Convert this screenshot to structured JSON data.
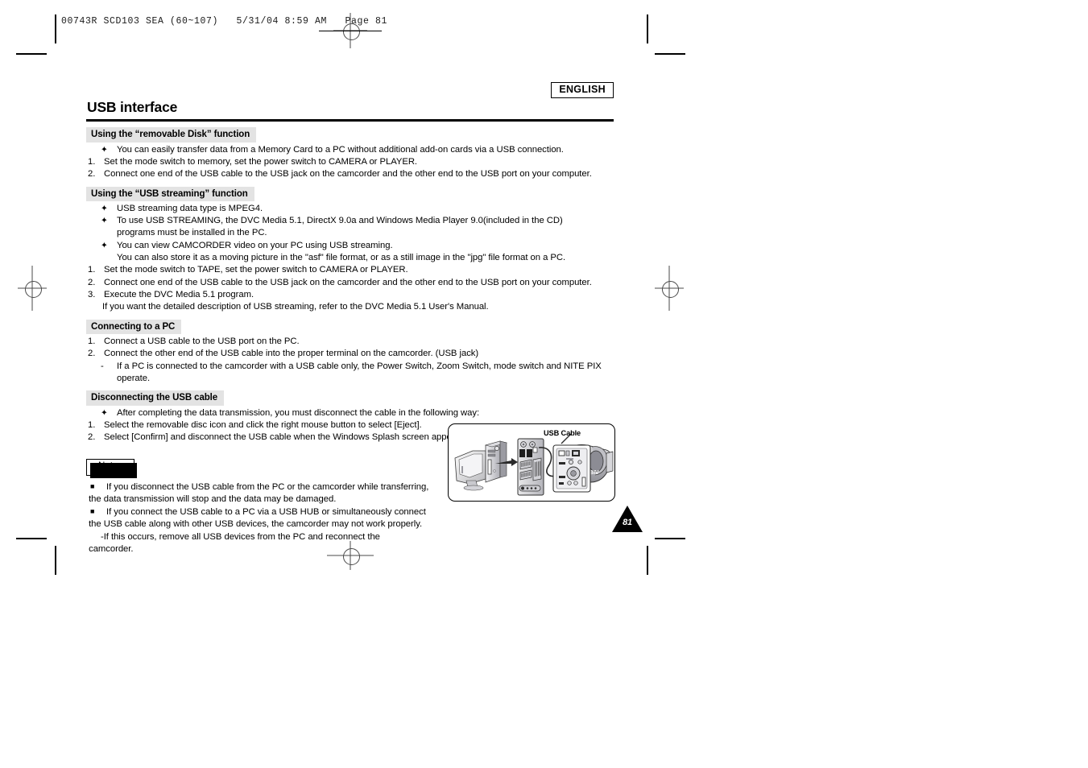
{
  "printer_slug": "00743R SCD103 SEA (60~107)   5/31/04 8:59 AM   Page 81",
  "header": {
    "language_badge": "ENGLISH",
    "title": "USB interface"
  },
  "sections": [
    {
      "heading": "Using the “removable Disk” function",
      "lines": [
        {
          "marker": "club",
          "text": "You can easily transfer data from a Memory Card to a PC without additional add-on cards via a USB connection."
        },
        {
          "marker": "1.",
          "text": "Set the mode switch to memory, set the power switch to CAMERA or PLAYER."
        },
        {
          "marker": "2.",
          "text": "Connect one end of the USB cable to the USB jack on the camcorder and the other end to the USB port on your computer."
        }
      ]
    },
    {
      "heading": "Using the “USB streaming” function",
      "lines": [
        {
          "marker": "club",
          "text": "USB streaming data type is MPEG4."
        },
        {
          "marker": "club",
          "text": "To use USB STREAMING, the DVC Media 5.1, DirectX 9.0a and Windows Media Player 9.0(included in the CD)"
        },
        {
          "marker": "cont-club",
          "text": "programs must be installed in the PC."
        },
        {
          "marker": "club",
          "text": "You can view CAMCORDER video on your PC using USB streaming."
        },
        {
          "marker": "cont-club",
          "text": "You can also store it as a moving picture in the \"asf\" file format, or as a still image in the \"jpg\" file format on a PC."
        },
        {
          "marker": "1.",
          "text": "Set the mode switch to TAPE, set the power switch to CAMERA or PLAYER."
        },
        {
          "marker": "2.",
          "text": "Connect one end of the USB cable to the USB jack on the camcorder and the other end to the USB port on your computer."
        },
        {
          "marker": "3.",
          "text": "Execute the DVC Media 5.1 program."
        },
        {
          "marker": "cont",
          "text": "If you want the detailed description of USB streaming, refer to the DVC Media 5.1 User's Manual."
        }
      ]
    },
    {
      "heading": "Connecting to a PC",
      "lines": [
        {
          "marker": "1.",
          "text": "Connect a USB cable to the USB port on the PC."
        },
        {
          "marker": "2.",
          "text": "Connect the other end of the USB cable into the proper terminal on the camcorder. (USB jack)"
        },
        {
          "marker": "dash",
          "text": "If a PC is connected to the camcorder with a USB cable only, the Power Switch, Zoom Switch, mode switch and NITE PIX"
        },
        {
          "marker": "cont-dash",
          "text": "operate."
        }
      ]
    },
    {
      "heading": "Disconnecting the USB cable",
      "lines": [
        {
          "marker": "club",
          "text": "After completing the data transmission, you must disconnect the cable in the following way:"
        },
        {
          "marker": "1.",
          "text": "Select the removable disc icon and click the right mouse button to select [Eject]."
        },
        {
          "marker": "2.",
          "text": "Select [Confirm] and disconnect the USB cable when the Windows Splash screen appears."
        }
      ]
    }
  ],
  "notes": {
    "tag_label": "Notes",
    "lines": [
      {
        "marker": "square",
        "text": "If you disconnect the USB cable from the PC or the camcorder while transferring,"
      },
      {
        "marker": "cont",
        "text": "the data transmission will stop and the data may be damaged."
      },
      {
        "marker": "square",
        "text": "If you connect the USB cable to a PC via a USB HUB or simultaneously connect"
      },
      {
        "marker": "cont",
        "text": "the USB cable along with other USB devices, the camcorder may not work properly."
      },
      {
        "marker": "dash",
        "text": "If this occurs, remove all USB devices from the PC and reconnect the"
      },
      {
        "marker": "cont-dash",
        "text": "camcorder."
      }
    ]
  },
  "illustration": {
    "label": "USB Cable",
    "alt": "Diagram showing a desktop PC connected via a USB cable to a camcorder"
  },
  "page_number": "81",
  "glyphs": {
    "club_bullet": "✦",
    "square_bullet": "■",
    "dash": "-"
  },
  "colors": {
    "section_heading_bg": "#e3e3e3",
    "rule": "#000000",
    "page_background": "#ffffff"
  }
}
